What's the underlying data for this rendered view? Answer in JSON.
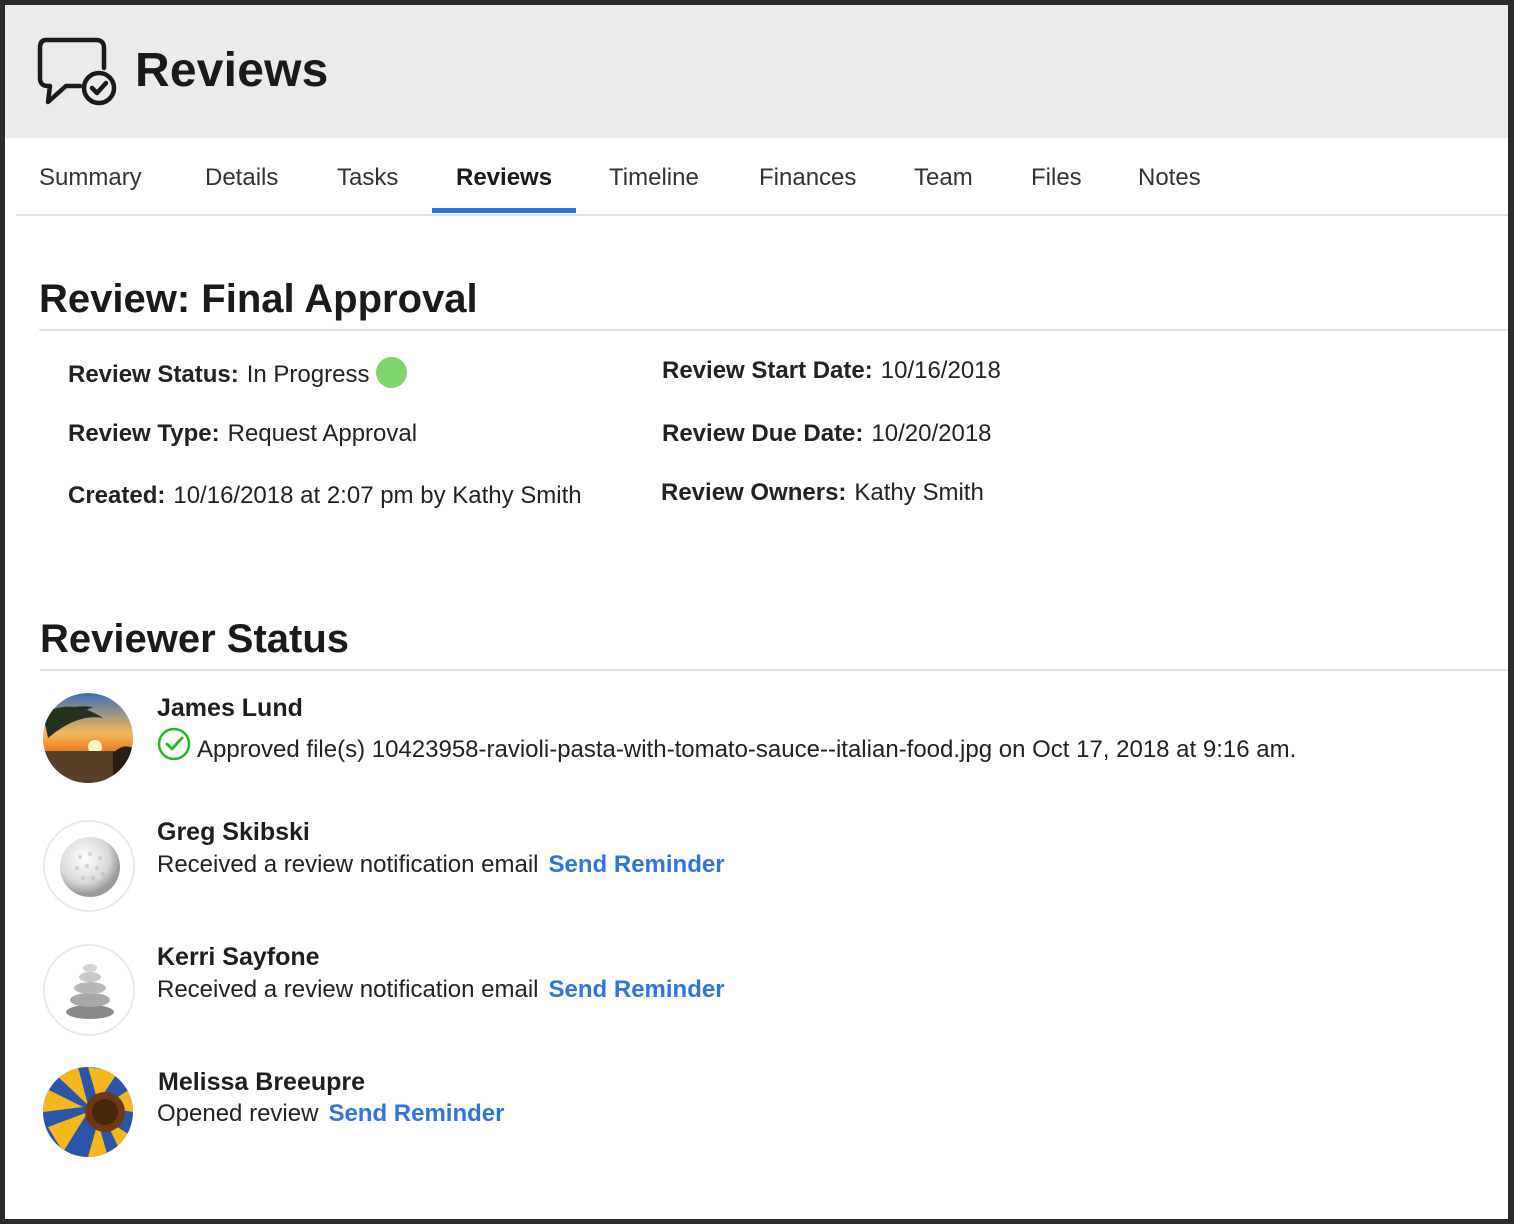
{
  "app": {
    "title": "Reviews",
    "icon": "chat-bubble-check-icon"
  },
  "tabs": [
    {
      "label": "Summary",
      "active": false
    },
    {
      "label": "Details",
      "active": false
    },
    {
      "label": "Tasks",
      "active": false
    },
    {
      "label": "Reviews",
      "active": true
    },
    {
      "label": "Timeline",
      "active": false
    },
    {
      "label": "Finances",
      "active": false
    },
    {
      "label": "Team",
      "active": false
    },
    {
      "label": "Files",
      "active": false
    },
    {
      "label": "Notes",
      "active": false
    }
  ],
  "review": {
    "title": "Review: Final Approval",
    "status_label": "Review Status:",
    "status_value": "In Progress",
    "status_color": "#7fd66a",
    "type_label": "Review Type:",
    "type_value": "Request Approval",
    "created_label": "Created:",
    "created_value": "10/16/2018  at 2:07 pm by Kathy Smith",
    "start_label": "Review Start Date:",
    "start_value": "10/16/2018",
    "due_label": "Review Due Date:",
    "due_value": "10/20/2018",
    "owners_label": "Review Owners:",
    "owners_value": "Kathy Smith"
  },
  "reviewer_status": {
    "title": "Reviewer Status",
    "reviewers": [
      {
        "name": "James Lund",
        "status": "Approved file(s) 10423958-ravioli-pasta-with-tomato-sauce--italian-food.jpg on  Oct 17, 2018 at 9:16 am.",
        "icon": "check-circle-icon",
        "avatar": "beach-sunset"
      },
      {
        "name": "Greg Skibski",
        "status": "Received a review notification email",
        "action": "Send Reminder",
        "avatar": "golf-ball"
      },
      {
        "name": "Kerri Sayfone",
        "status": "Received a review notification email",
        "action": "Send Reminder",
        "avatar": "stacked-stones"
      },
      {
        "name": "Melissa Breeupre",
        "status": "Opened review",
        "action": "Send Reminder",
        "avatar": "sunflower"
      }
    ]
  },
  "colors": {
    "accent": "#2f74e0",
    "approved": "#1fb81f",
    "header_bg": "#ebebeb"
  }
}
